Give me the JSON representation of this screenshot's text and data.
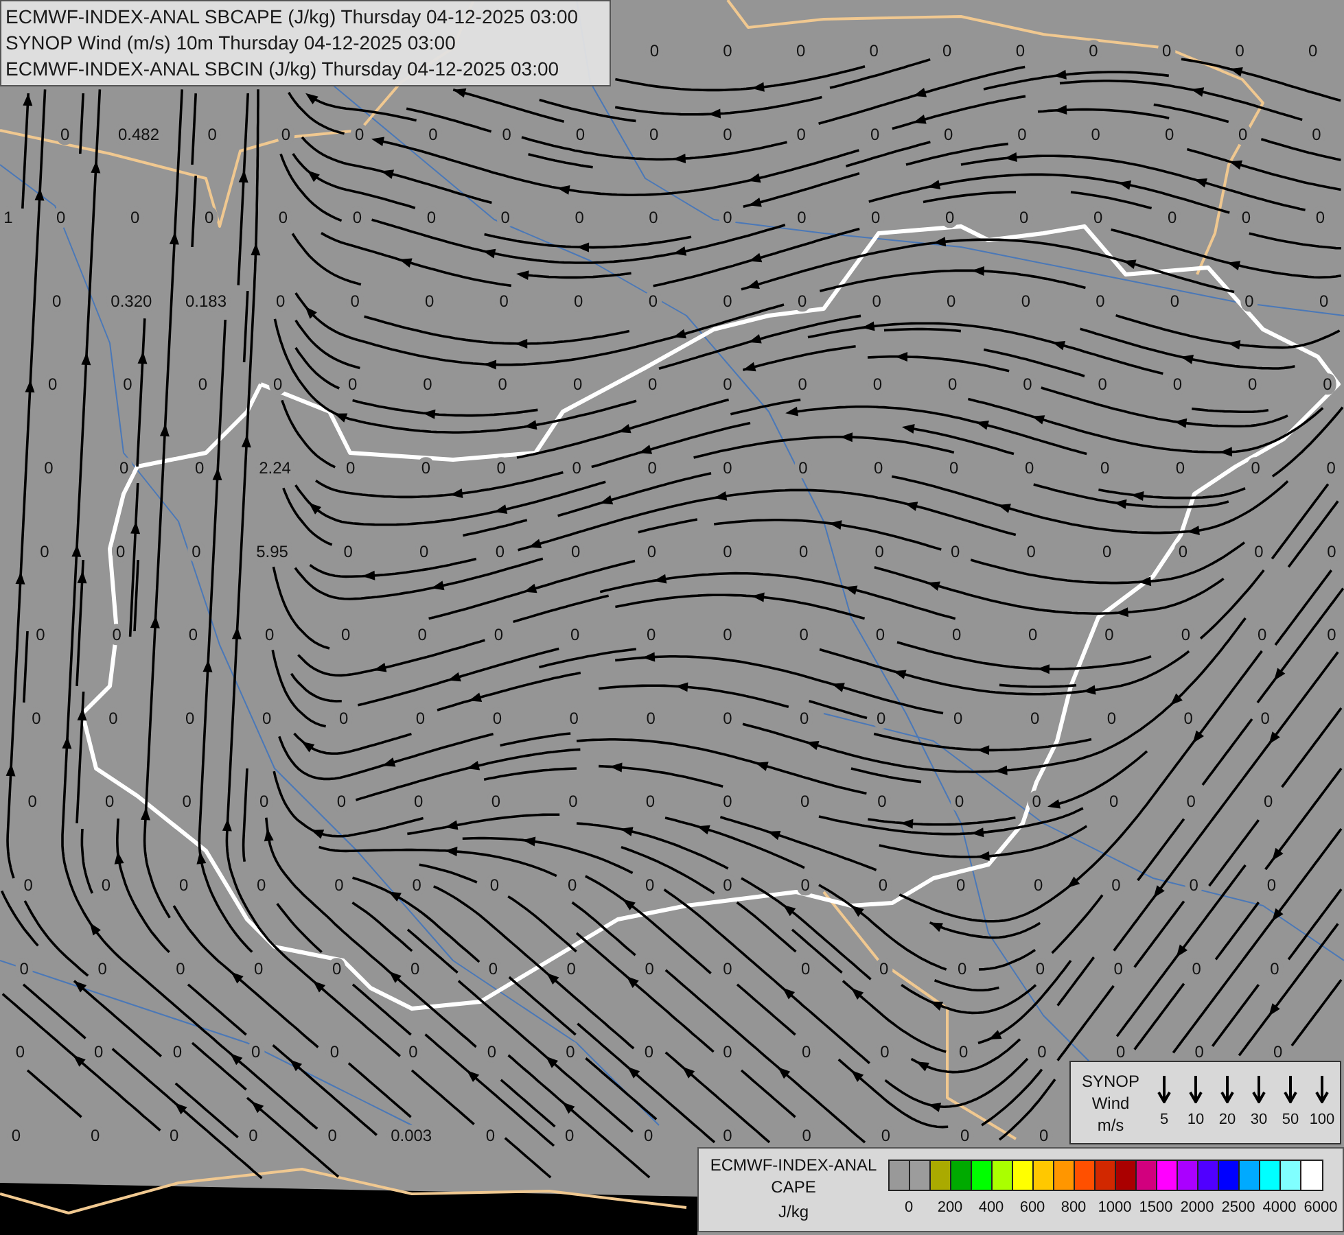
{
  "title_box": {
    "lines": [
      "ECMWF-INDEX-ANAL SBCAPE (J/kg) Thursday 04-12-2025 03:00",
      "SYNOP Wind (m/s) 10m Thursday 04-12-2025 03:00",
      "ECMWF-INDEX-ANAL SBCIN (J/kg) Thursday 04-12-2025 03:00"
    ]
  },
  "cape_grid": {
    "rows": [
      [
        null,
        null,
        null,
        null,
        null,
        null,
        null,
        null,
        null,
        "0",
        "0",
        "0",
        "0",
        "0",
        "0",
        "0",
        "0",
        "0",
        "0"
      ],
      [
        null,
        "0",
        "0.482",
        "0",
        "0",
        "0",
        "0",
        "0",
        "0",
        "0",
        "0",
        "0",
        "0",
        "0",
        "0",
        "0",
        "0",
        "0",
        "0"
      ],
      [
        "1",
        "0",
        "0",
        "0",
        "0",
        "0",
        "0",
        "0",
        "0",
        "0",
        "0",
        "0",
        "0",
        "0",
        "0",
        "0",
        "0",
        "0",
        "0"
      ],
      [
        null,
        "0",
        "0.320",
        "0.183",
        "0",
        "0",
        "0",
        "0",
        "0",
        "0",
        "0",
        "0",
        "0",
        "0",
        "0",
        "0",
        "0",
        "0",
        "0"
      ],
      [
        null,
        "0",
        "0",
        "0",
        "0",
        "0",
        "0",
        "0",
        "0",
        "0",
        "0",
        "0",
        "0",
        "0",
        "0",
        "0",
        "0",
        "0",
        "0"
      ],
      [
        null,
        "0",
        "0",
        "0",
        "2.24",
        "0",
        "0",
        "0",
        "0",
        "0",
        "0",
        "0",
        "0",
        "0",
        "0",
        "0",
        "0",
        "0",
        "0"
      ],
      [
        null,
        "0",
        "0",
        "0",
        "5.95",
        "0",
        "0",
        "0",
        "0",
        "0",
        "0",
        "0",
        "0",
        "0",
        "0",
        "0",
        "0",
        "0",
        "0"
      ],
      [
        null,
        "0",
        "0",
        "0",
        "0",
        "0",
        "0",
        "0",
        "0",
        "0",
        "0",
        "0",
        "0",
        "0",
        "0",
        "0",
        "0",
        "0",
        "0"
      ],
      [
        null,
        "0",
        "0",
        "0",
        "0",
        "0",
        "0",
        "0",
        "0",
        "0",
        "0",
        "0",
        "0",
        "0",
        "0",
        "0",
        "0",
        "0",
        null
      ],
      [
        null,
        "0",
        "0",
        "0",
        "0",
        "0",
        "0",
        "0",
        "0",
        "0",
        "0",
        "0",
        "0",
        "0",
        "0",
        "0",
        "0",
        "0",
        null
      ],
      [
        null,
        "0",
        "0",
        "0",
        "0",
        "0",
        "0",
        "0",
        "0",
        "0",
        "0",
        "0",
        "0",
        "0",
        "0",
        "0",
        "0",
        "0",
        null
      ],
      [
        null,
        "0",
        "0",
        "0",
        "0",
        "0",
        "0",
        "0",
        "0",
        "0",
        "0",
        "0",
        "0",
        "0",
        "0",
        "0",
        "0",
        "0",
        null
      ],
      [
        null,
        "0",
        "0",
        "0",
        "0",
        "0",
        "0",
        "0",
        "0",
        "0",
        "0",
        "0",
        "0",
        "0",
        "0",
        "0",
        "0",
        "0",
        null
      ],
      [
        null,
        "0",
        "0",
        "0",
        "0",
        "0",
        "0.003",
        "0",
        "0",
        "0",
        "0",
        "0",
        "0",
        "0",
        "0",
        null,
        null,
        null,
        null
      ]
    ]
  },
  "synop_legend": {
    "lines": [
      "SYNOP",
      "Wind",
      "m/s"
    ],
    "speeds": [
      "5",
      "10",
      "20",
      "30",
      "50",
      "100"
    ]
  },
  "cape_legend": {
    "lines": [
      "ECMWF-INDEX-ANAL",
      "CAPE"
    ],
    "unit": "J/kg",
    "swatches": [
      {
        "color": "#999999"
      },
      {
        "color": "#9c9c9c"
      },
      {
        "color": "#aaaa00"
      },
      {
        "color": "#00aa00"
      },
      {
        "color": "#00ff00"
      },
      {
        "color": "#aaff00"
      },
      {
        "color": "#ffff00"
      },
      {
        "color": "#ffc800"
      },
      {
        "color": "#ff9600"
      },
      {
        "color": "#ff5000"
      },
      {
        "color": "#d22800"
      },
      {
        "color": "#aa0000"
      },
      {
        "color": "#d2007e"
      },
      {
        "color": "#ff00ff"
      },
      {
        "color": "#aa00ff"
      },
      {
        "color": "#5000ff"
      },
      {
        "color": "#0000ff"
      },
      {
        "color": "#00aaff"
      },
      {
        "color": "#00ffff"
      },
      {
        "color": "#80ffff"
      },
      {
        "color": "#ffffff"
      }
    ],
    "ticks": [
      "0",
      "200",
      "400",
      "600",
      "800",
      "1000",
      "1500",
      "2000",
      "2500",
      "4000",
      "6000"
    ]
  }
}
